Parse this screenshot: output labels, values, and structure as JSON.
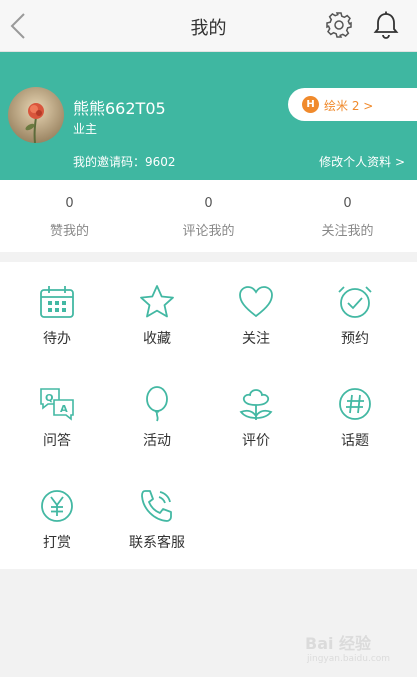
{
  "header": {
    "title": "我的",
    "back_icon": "chevron-left-icon",
    "settings_icon": "gear-icon",
    "notifications_icon": "bell-icon"
  },
  "profile": {
    "username": "熊熊662T05",
    "role": "业主",
    "invite": "我的邀请码：9602",
    "edit_link": "修改个人资料 >",
    "points_badge": "H",
    "points": "绘米 2 >"
  },
  "stats": [
    {
      "count": "0",
      "label": "赞我的"
    },
    {
      "count": "0",
      "label": "评论我的"
    },
    {
      "count": "0",
      "label": "关注我的"
    }
  ],
  "menu": [
    {
      "label": "待办",
      "icon": "calendar-icon"
    },
    {
      "label": "收藏",
      "icon": "star-icon"
    },
    {
      "label": "关注",
      "icon": "heart-icon"
    },
    {
      "label": "预约",
      "icon": "alarm-clock-icon"
    },
    {
      "label": "问答",
      "icon": "qa-icon"
    },
    {
      "label": "活动",
      "icon": "balloon-icon"
    },
    {
      "label": "评价",
      "icon": "flower-icon"
    },
    {
      "label": "话题",
      "icon": "hashtag-icon"
    },
    {
      "label": "打赏",
      "icon": "yen-icon"
    },
    {
      "label": "联系客服",
      "icon": "phone-icon"
    }
  ],
  "colors": {
    "primary": "#3fb7a1",
    "accent": "#f08a2c",
    "icon": "#43b8a3"
  },
  "watermark": {
    "text": "Bai 经验",
    "sub": "jingyan.baidu.com"
  }
}
